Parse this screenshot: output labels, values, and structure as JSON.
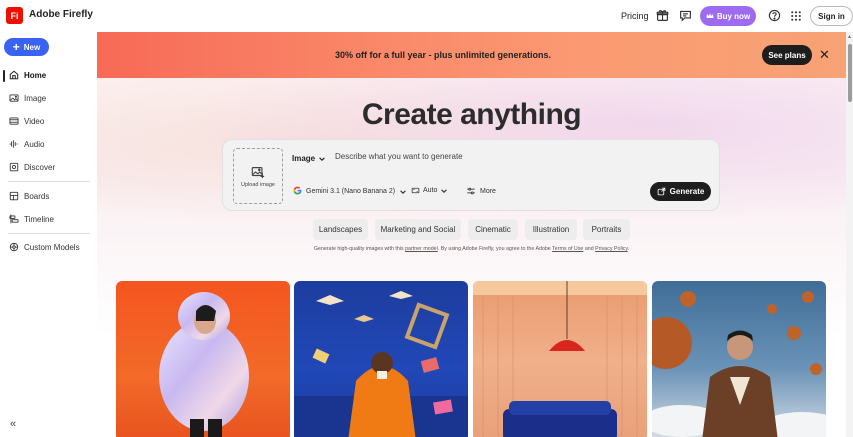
{
  "app": {
    "logo_text": "Fi",
    "brand": "Adobe Firefly"
  },
  "topbar": {
    "pricing": "Pricing",
    "icons": [
      "gift-icon",
      "chat-icon"
    ],
    "buy_now": "Buy now",
    "help_icon": "help-icon",
    "apps_icon": "apps-grid-icon",
    "sign_in": "Sign in",
    "colors": {
      "buy_now": "#9d6bf2",
      "logo": "#eb1000"
    }
  },
  "sidebar": {
    "new_label": "New",
    "items": [
      {
        "label": "Home",
        "icon": "home-icon",
        "active": true
      },
      {
        "label": "Image",
        "icon": "image-icon"
      },
      {
        "label": "Video",
        "icon": "video-icon"
      },
      {
        "label": "Audio",
        "icon": "audio-icon"
      },
      {
        "label": "Discover",
        "icon": "discover-icon"
      },
      {
        "label": "Boards",
        "icon": "boards-icon"
      },
      {
        "label": "Timeline",
        "icon": "timeline-icon"
      },
      {
        "label": "Custom Models",
        "icon": "custom-models-icon"
      }
    ],
    "collapse_icon": "collapse-icon"
  },
  "promo": {
    "text": "30% off for a full year  - plus unlimited generations.",
    "see_plans": "See plans",
    "close_icon": "close-icon"
  },
  "hero": {
    "title": "Create anything"
  },
  "prompt": {
    "upload_label": "Upload image",
    "mode": "Image",
    "placeholder": "Describe what you want to generate",
    "model": "Gemini 3.1 (Nano Banana 2)",
    "aspect": "Auto",
    "more": "More",
    "generate": "Generate"
  },
  "chips": [
    "Landscapes",
    "Marketing and Social",
    "Cinematic",
    "Illustration",
    "Portraits"
  ],
  "disclaimer": {
    "part1": "Generate high-quality images with this ",
    "link1": "partner model",
    "part2": ". By using Adobe Firefly, you agree to the Adobe ",
    "link2": "Terms of Use",
    "part3": " and ",
    "link3": "Privacy Policy",
    "part4": "."
  },
  "gallery": [
    {
      "subject": "person in iridescent puffer jacket on orange background"
    },
    {
      "subject": "man in orange coat reading with flying books on blue background"
    },
    {
      "subject": "peach room with red pendant lamp and blue sofa"
    },
    {
      "subject": "man in varsity jacket with floating basketballs and sky"
    }
  ]
}
